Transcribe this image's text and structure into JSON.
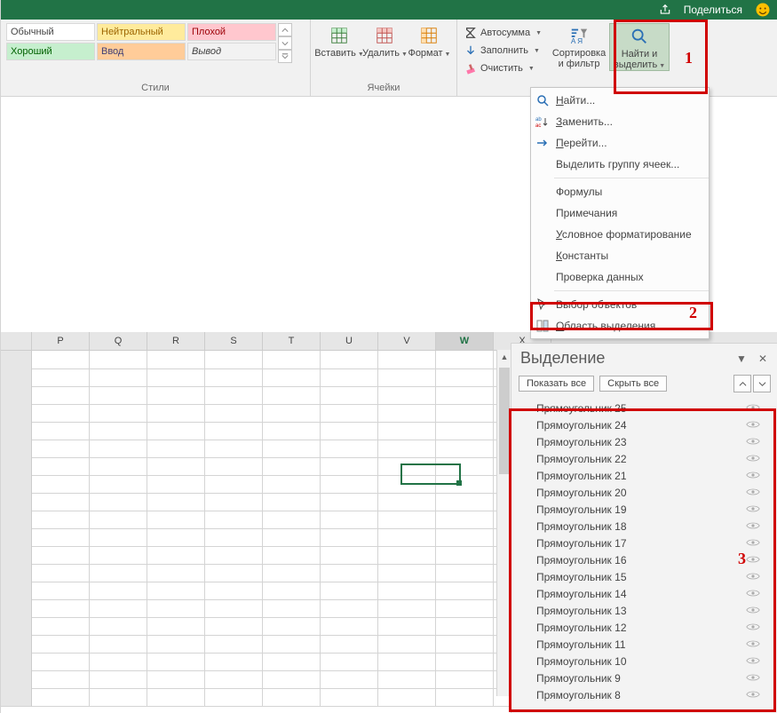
{
  "titlebar": {
    "share": "Поделиться"
  },
  "ribbon": {
    "styles": {
      "label": "Стили",
      "items": [
        "Обычный",
        "Нейтральный",
        "Плохой",
        "Хороший",
        "Ввод",
        "Вывод"
      ]
    },
    "cells": {
      "label": "Ячейки",
      "insert": "Вставить",
      "delete": "Удалить",
      "format": "Формат"
    },
    "editing": {
      "autosum": "Автосумма",
      "fill": "Заполнить",
      "clear": "Очистить",
      "sort": "Сортировка\nи фильтр",
      "find": "Найти и\nвыделить"
    }
  },
  "menu": {
    "find": "Найти...",
    "replace": "Заменить...",
    "goto": "Перейти...",
    "goto_special": "Выделить группу ячеек...",
    "formulas": "Формулы",
    "comments": "Примечания",
    "cond_fmt": "Условное форматирование",
    "constants": "Константы",
    "validation": "Проверка данных",
    "select_objects": "Выбор объектов",
    "selection_pane": "Область выделения..."
  },
  "columns": [
    "",
    "P",
    "Q",
    "R",
    "S",
    "T",
    "U",
    "V",
    "W",
    "X"
  ],
  "active_cell": "W",
  "pane": {
    "title": "Выделение",
    "show_all": "Показать все",
    "hide_all": "Скрыть все",
    "items": [
      "Прямоугольник 25",
      "Прямоугольник 24",
      "Прямоугольник 23",
      "Прямоугольник 22",
      "Прямоугольник 21",
      "Прямоугольник 20",
      "Прямоугольник 19",
      "Прямоугольник 18",
      "Прямоугольник 17",
      "Прямоугольник 16",
      "Прямоугольник 15",
      "Прямоугольник 14",
      "Прямоугольник 13",
      "Прямоугольник 12",
      "Прямоугольник 11",
      "Прямоугольник 10",
      "Прямоугольник 9",
      "Прямоугольник 8"
    ]
  },
  "annotations": {
    "n1": "1",
    "n2": "2",
    "n3": "3"
  }
}
